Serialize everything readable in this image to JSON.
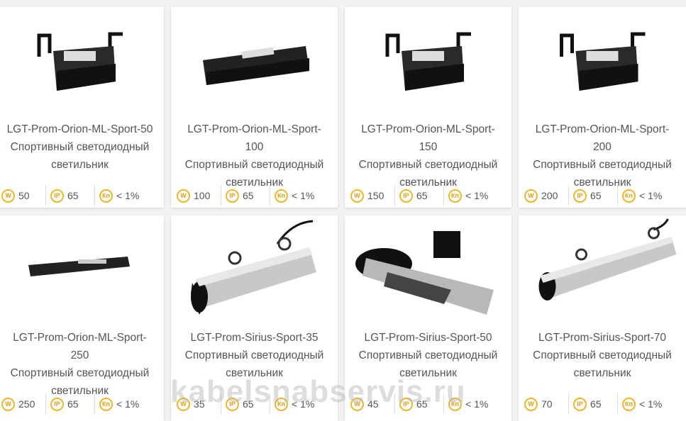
{
  "colors": {
    "badge": "#f0b429",
    "text": "#555555",
    "background": "#f2f2f2"
  },
  "badges": {
    "w": "W",
    "ip": "IP",
    "kp": "Кп"
  },
  "products": [
    {
      "title_lines": [
        "LGT-Prom-Orion-ML-Sport-50",
        "Спортивный светодиодный",
        "светильник"
      ],
      "power": "50",
      "ip": "65",
      "kp": "< 1%",
      "image": "orion-bracket-lamp"
    },
    {
      "title_lines": [
        "LGT-Prom-Orion-ML-Sport-",
        "100",
        "Спортивный светодиодный",
        "светильник"
      ],
      "power": "100",
      "ip": "65",
      "kp": "< 1%",
      "image": "orion-lamp"
    },
    {
      "title_lines": [
        "LGT-Prom-Orion-ML-Sport-",
        "150",
        "Спортивный светодиодный",
        "светильник"
      ],
      "power": "150",
      "ip": "65",
      "kp": "< 1%",
      "image": "orion-bracket-lamp"
    },
    {
      "title_lines": [
        "LGT-Prom-Orion-ML-Sport-",
        "200",
        "Спортивный светодиодный",
        "светильник"
      ],
      "power": "200",
      "ip": "65",
      "kp": "< 1%",
      "image": "orion-bracket-lamp"
    },
    {
      "title_lines": [
        "LGT-Prom-Orion-ML-Sport-",
        "250",
        "Спортивный светодиодный",
        "светильник"
      ],
      "power": "250",
      "ip": "65",
      "kp": "< 1%",
      "image": "orion-flat-lamp"
    },
    {
      "title_lines": [
        "LGT-Prom-Sirius-Sport-35",
        "Спортивный светодиодный",
        "светильник"
      ],
      "power": "35",
      "ip": "65",
      "kp": "< 1%",
      "image": "sirius-lamp"
    },
    {
      "title_lines": [
        "LGT-Prom-Sirius-Sport-50",
        "Спортивный светодиодный",
        "светильник"
      ],
      "power": "45",
      "ip": "65",
      "kp": "< 1%",
      "image": "sirius-bracket-lamp"
    },
    {
      "title_lines": [
        "LGT-Prom-Sirius-Sport-70",
        "Спортивный светодиодный",
        "светильник"
      ],
      "power": "70",
      "ip": "65",
      "kp": "< 1%",
      "image": "sirius-long-lamp"
    }
  ],
  "watermark": "kabelsnabservis.ru"
}
